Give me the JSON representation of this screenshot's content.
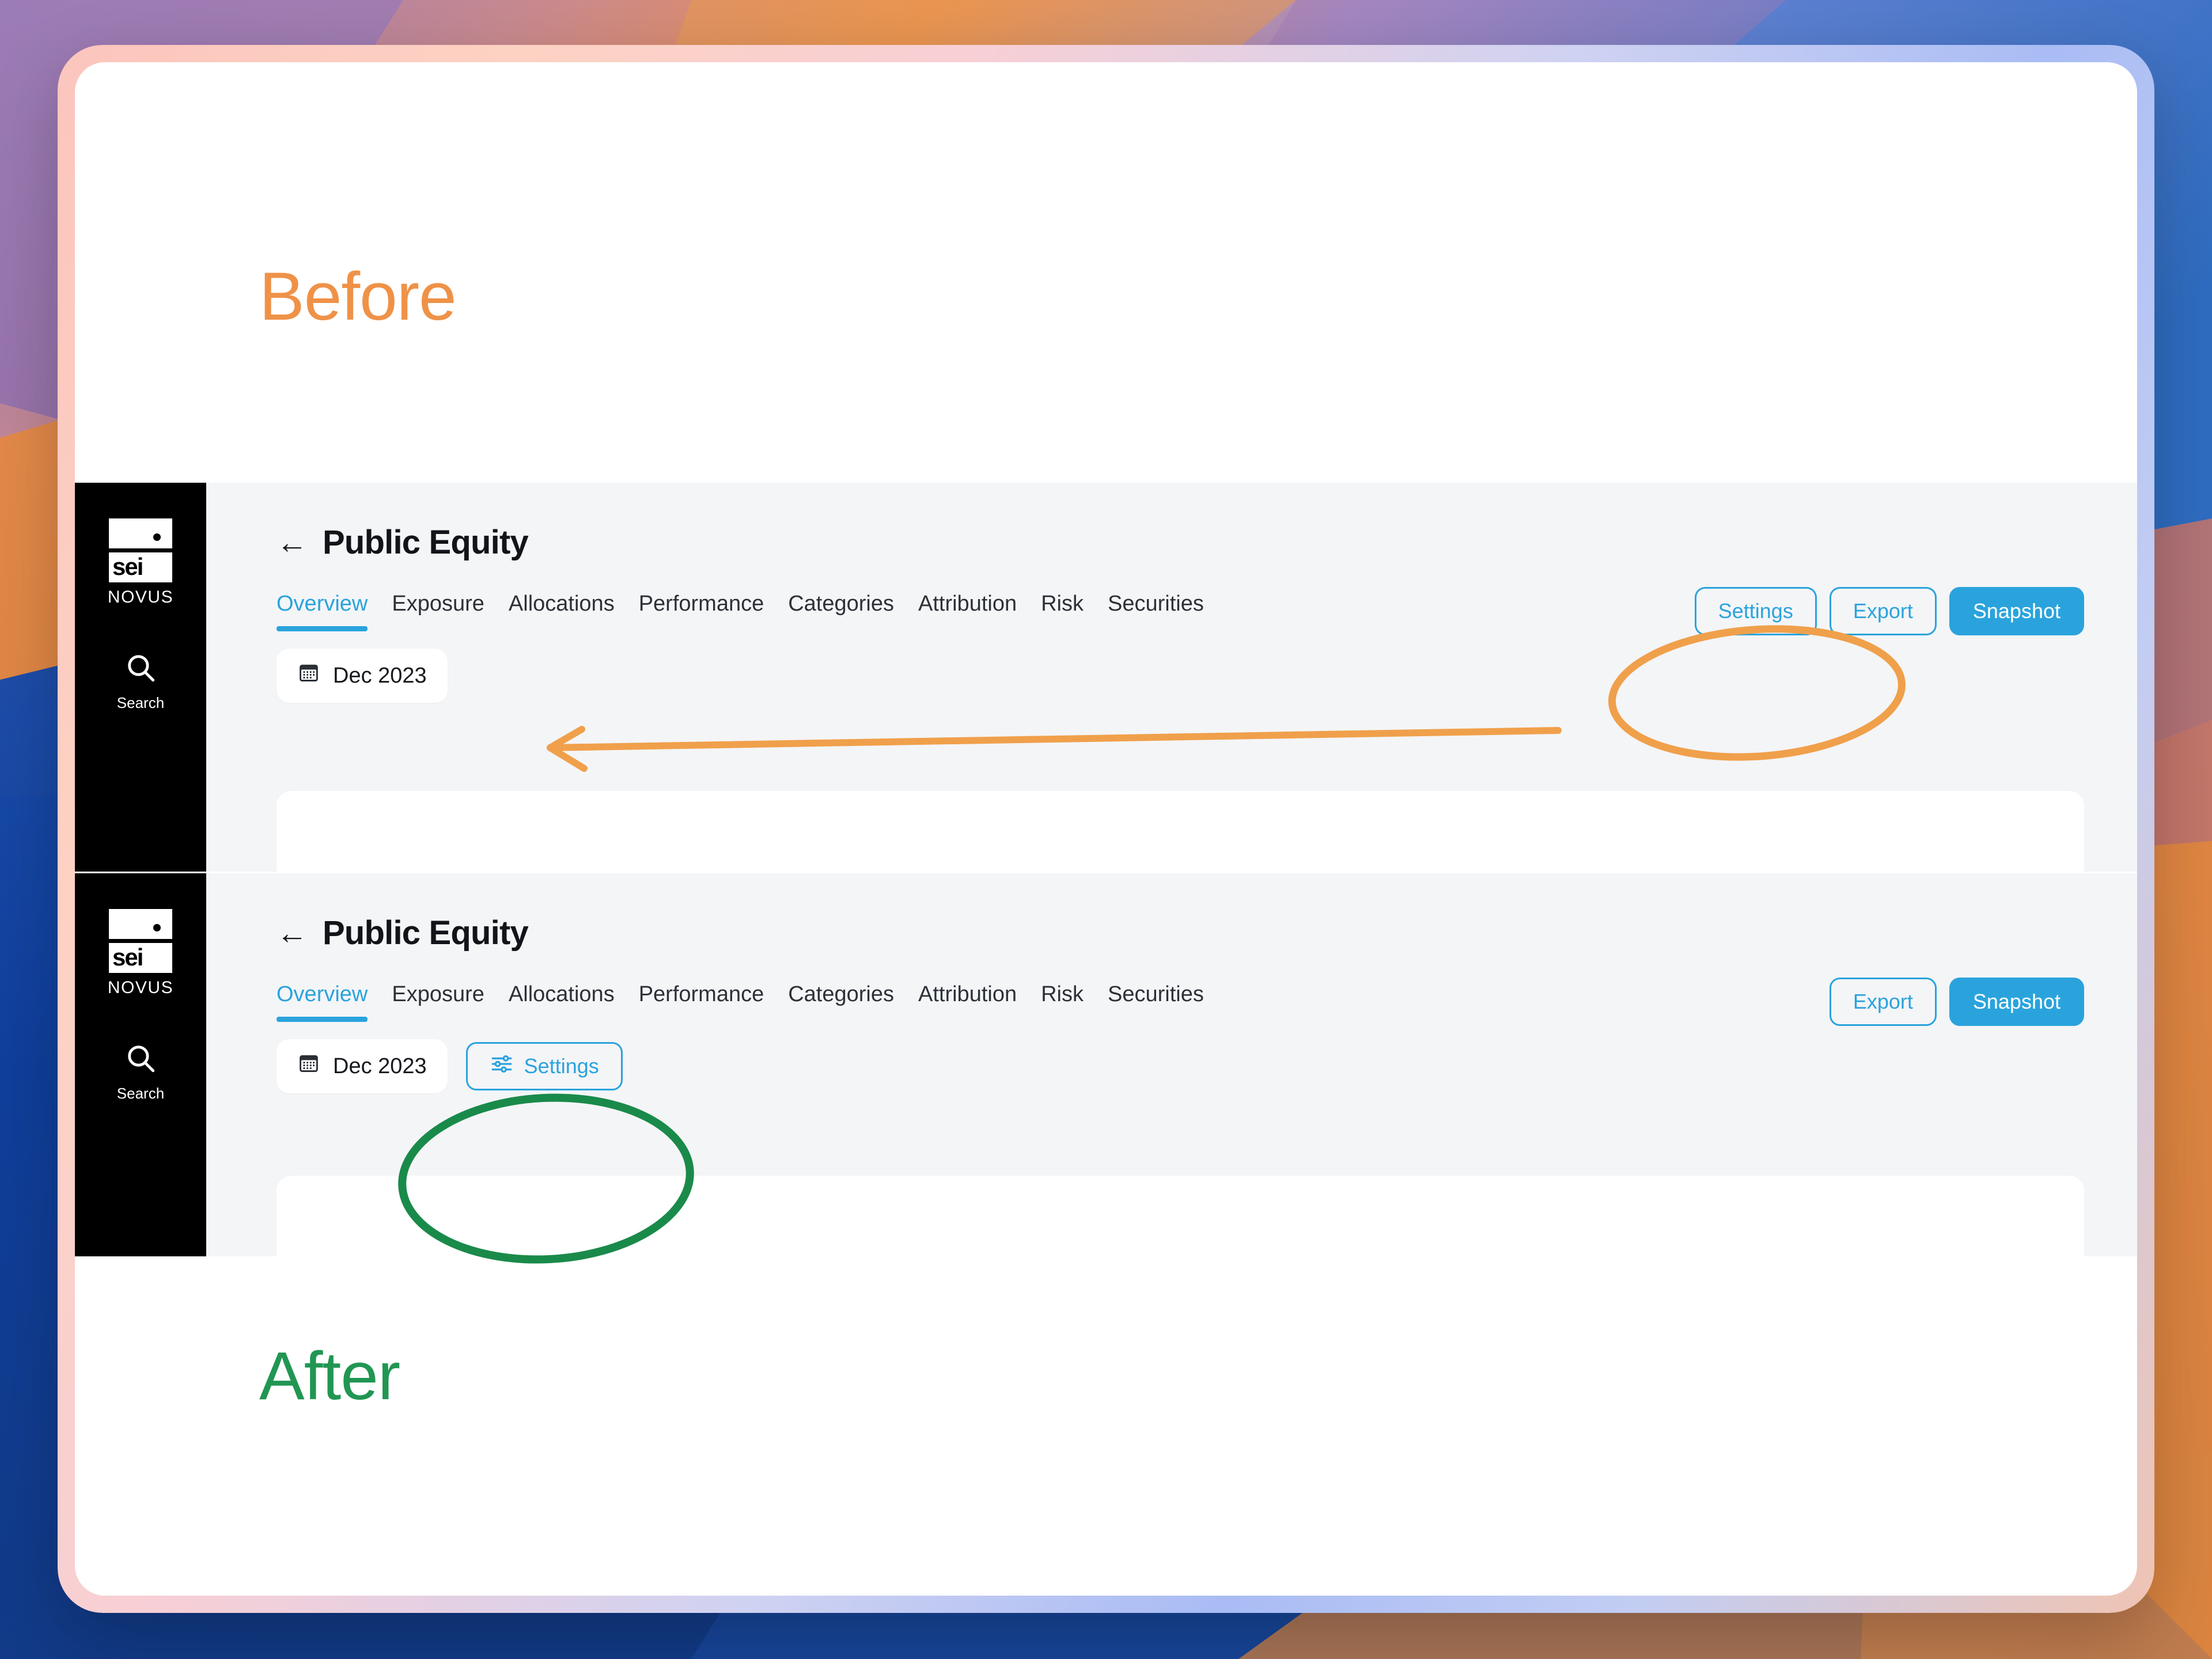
{
  "slide": {
    "before_label": "Before",
    "after_label": "After"
  },
  "colors": {
    "accent_blue": "#2aa3dd",
    "before_orange": "#ef9248",
    "after_green": "#219653",
    "annotation_orange": "#f0a04b",
    "annotation_green": "#1a8a4a",
    "sidebar_black": "#000000",
    "app_background": "#f4f5f7"
  },
  "sidebar": {
    "logo_word": "sei",
    "logo_sub": "NOVUS",
    "search_label": "Search",
    "search_icon": "search-icon"
  },
  "app": {
    "back_icon": "arrow-left-icon",
    "title": "Public Equity",
    "tabs": [
      {
        "label": "Overview",
        "active": true
      },
      {
        "label": "Exposure",
        "active": false
      },
      {
        "label": "Allocations",
        "active": false
      },
      {
        "label": "Performance",
        "active": false
      },
      {
        "label": "Categories",
        "active": false
      },
      {
        "label": "Attribution",
        "active": false
      },
      {
        "label": "Risk",
        "active": false
      },
      {
        "label": "Securities",
        "active": false
      }
    ],
    "date_filter": {
      "icon": "calendar-icon",
      "value": "Dec 2023"
    },
    "settings_label": "Settings",
    "settings_icon": "sliders-icon",
    "export_label": "Export",
    "snapshot_label": "Snapshot"
  },
  "annotations": {
    "before_ellipse": "orange-ellipse-around-header-settings",
    "before_arrow": "orange-arrow-pointing-to-date-filter",
    "after_ellipse": "green-ellipse-around-filter-settings"
  }
}
